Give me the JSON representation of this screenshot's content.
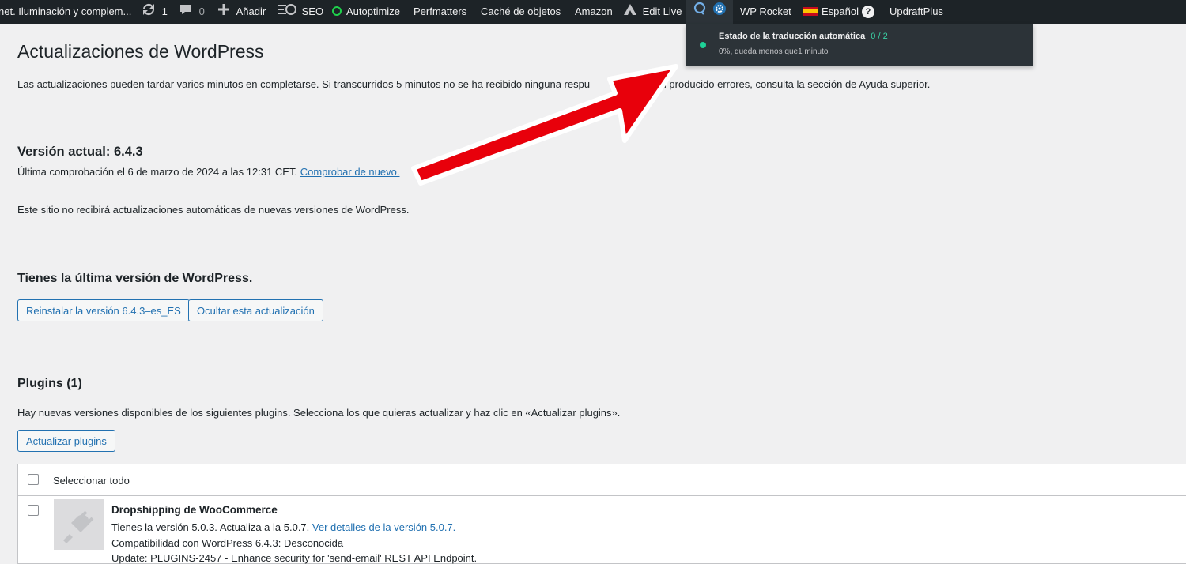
{
  "adminbar": {
    "site_name": "net. Iluminación y complem...",
    "updates_count": "1",
    "comments_count": "0",
    "new_label": "Añadir",
    "seo_label": "SEO",
    "autoptimize_label": "Autoptimize",
    "perfmatters_label": "Perfmatters",
    "object_cache_label": "Caché de objetos",
    "amazon_label": "Amazon",
    "edit_live_label": "Edit Live",
    "wp_rocket_label": "WP Rocket",
    "language_label": "Español",
    "updraft_label": "UpdraftPlus"
  },
  "translation_dropdown": {
    "title": "Estado de la traducción automática",
    "count": "0 / 2",
    "subtitle": "0%, queda menos que1 minuto"
  },
  "page": {
    "title": "Actualizaciones de WordPress",
    "notice_before": "Las actualizaciones pueden tardar varios minutos en completarse. Si transcurridos 5 minutos no se ha recibido ninguna respu",
    "notice_after": "nan producido errores, consulta la sección de Ayuda superior.",
    "current_version_heading": "Versión actual: 6.4.3",
    "last_check_text": "Última comprobación el 6 de marzo de 2024 a las 12:31 CET.",
    "check_again_link": "Comprobar de nuevo.",
    "auto_updates_text": "Este sitio no recibirá actualizaciones automáticas de nuevas versiones de WordPress.",
    "latest_heading": "Tienes la última versión de WordPress.",
    "reinstall_button": "Reinstalar la versión 6.4.3–es_ES",
    "hide_update_button": "Ocultar esta actualización",
    "plugins_heading": "Plugins (1)",
    "plugins_text": "Hay nuevas versiones disponibles de los siguientes plugins. Selecciona los que quieras actualizar y haz clic en «Actualizar plugins».",
    "update_plugins_button": "Actualizar plugins"
  },
  "plugins_table": {
    "select_all_label": "Seleccionar todo",
    "rows": [
      {
        "name": "Dropshipping de WooCommerce",
        "version_text": "Tienes la versión 5.0.3. Actualiza a la 5.0.7.",
        "details_link": "Ver detalles de la versión 5.0.7.",
        "compat_text": "Compatibilidad con WordPress 6.4.3: Desconocida",
        "update_note": "Update: PLUGINS-2457 - Enhance security for 'send-email' REST API Endpoint."
      }
    ]
  },
  "colors": {
    "adminbar_bg": "#1d2327",
    "link_blue": "#2271b1",
    "arrow_red": "#e8000b"
  }
}
